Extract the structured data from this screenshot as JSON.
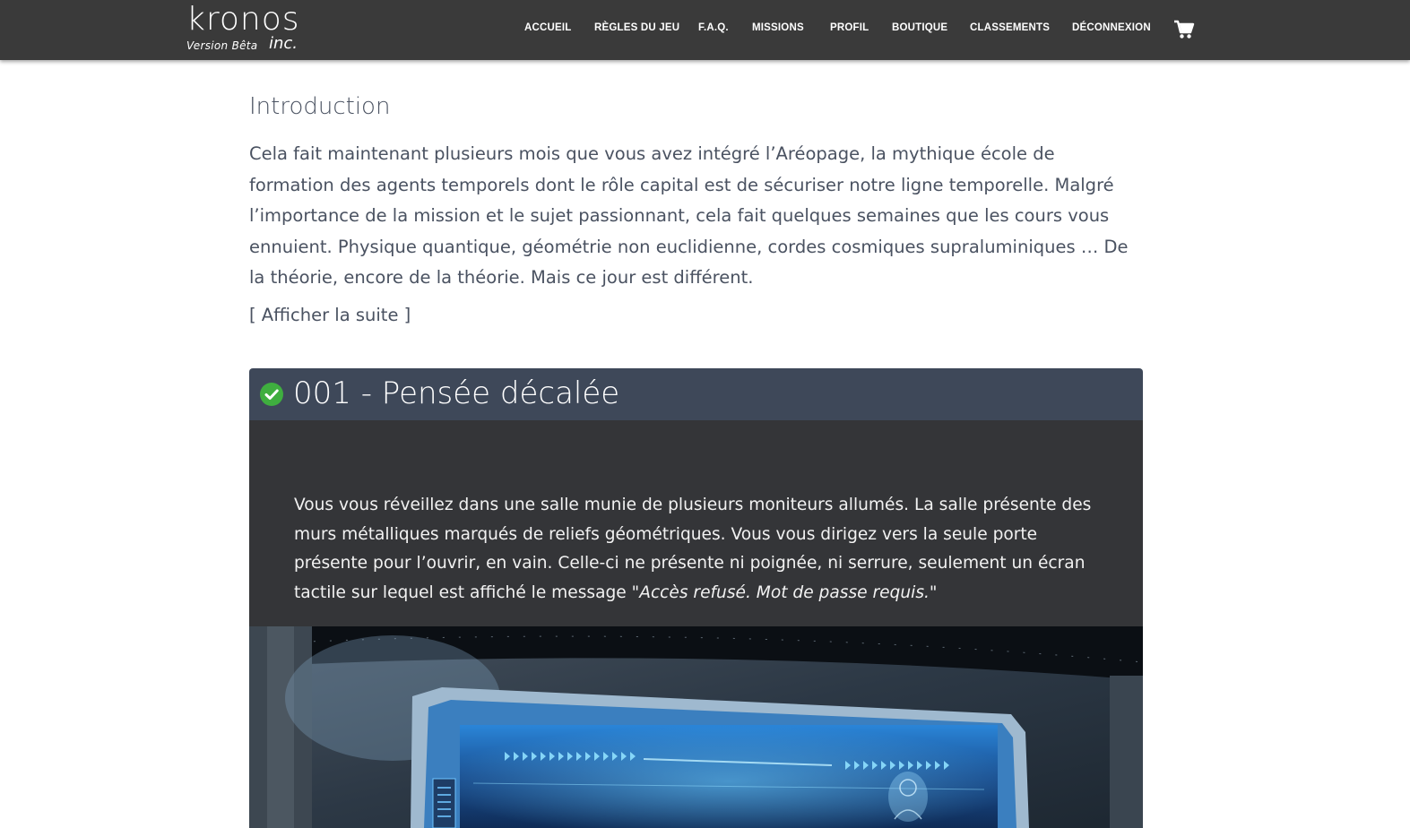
{
  "brand": {
    "logo_word": "kronos",
    "logo_suffix": "inc.",
    "version": "Version Bêta"
  },
  "nav": {
    "items": [
      "ACCUEIL",
      "RÈGLES DU JEU",
      "F.A.Q.",
      "MISSIONS",
      "PROFIL",
      "BOUTIQUE",
      "CLASSEMENTS",
      "DÉCONNEXION"
    ],
    "cart_icon": "shopping-cart-icon"
  },
  "intro": {
    "title": "Introduction",
    "text": "Cela fait maintenant plusieurs mois que vous avez intégré l’Aréopage, la mythique école de formation des agents temporels dont le rôle capital est de sécuriser notre ligne temporelle. Malgré l’importance de la mission et le sujet passionnant, cela fait quelques semaines que les cours vous ennuient. Physique quantique, géométrie non euclidienne, cordes cosmiques supraluminiques … De la théorie, encore de la théorie. Mais ce jour est différent.",
    "show_more": "[ Afficher la suite ]"
  },
  "mission": {
    "status_icon": "check-circle-icon",
    "status_color": "#3fae3f",
    "title": "001 - Pensée décalée",
    "text_before": "Vous vous réveillez dans une salle munie de plusieurs moniteurs allumés. La salle présente des murs métalliques marqués de reliefs géométriques. Vous vous dirigez vers la seule porte présente pour l’ouvrir, en vain. Celle-ci ne présente ni poignée, ni serrure, seulement un écran tactile sur lequel est affiché le message \"",
    "text_emphasis": "Accès refusé. Mot de passe requis.",
    "text_after": "\""
  },
  "colors": {
    "topbar": "#3a3a3a",
    "mission_header": "#3e4859",
    "mission_body": "#343538",
    "screen_glow": "#3aa6ff"
  }
}
